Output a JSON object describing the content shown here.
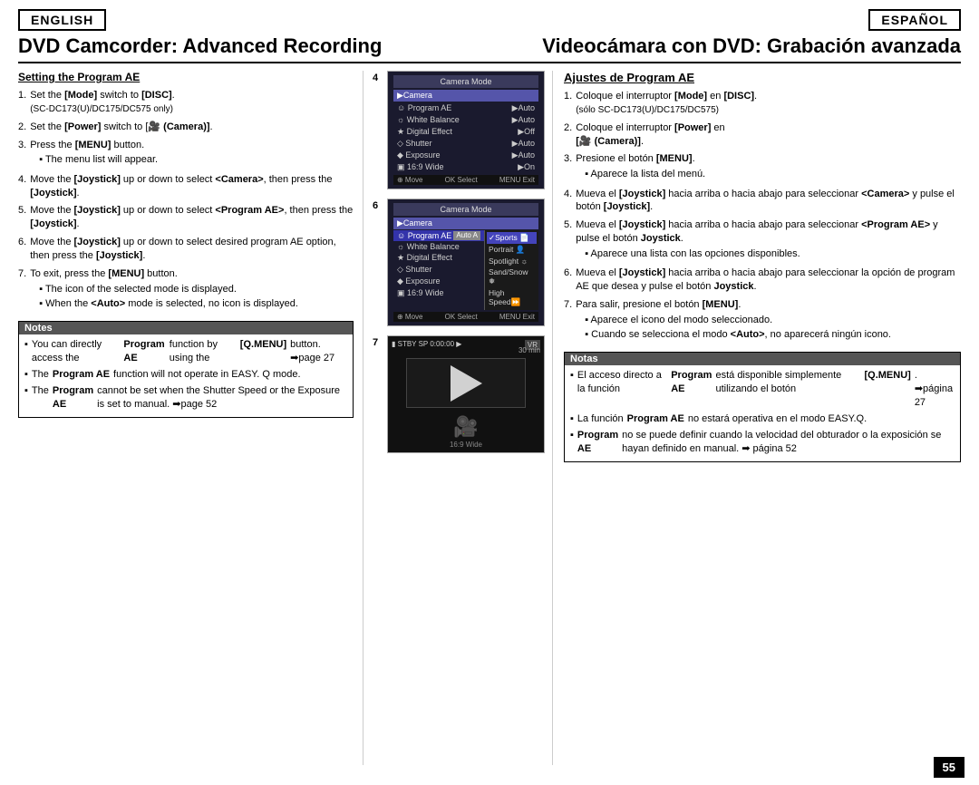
{
  "header": {
    "lang_en": "ENGLISH",
    "lang_es": "ESPAÑOL"
  },
  "title": {
    "en": "DVD Camcorder: Advanced Recording",
    "es": "Videocámara con DVD: Grabación avanzada"
  },
  "english_section": {
    "heading": "Setting the Program AE",
    "steps": [
      {
        "num": "1.",
        "text": "Set the [Mode] switch to [DISC].",
        "sub": "(SC-DC173(U)/DC175/DC575 only)"
      },
      {
        "num": "2.",
        "text": "Set the [Power] switch to [🎥 (Camera)]."
      },
      {
        "num": "3.",
        "text": "Press the [MENU] button.",
        "sub_bullets": [
          "The menu list will appear."
        ]
      },
      {
        "num": "4.",
        "text": "Move the [Joystick] up or down to select <Camera>, then press the [Joystick]."
      },
      {
        "num": "5.",
        "text": "Move the [Joystick] up or down to select <Program AE>, then press the [Joystick]."
      },
      {
        "num": "6.",
        "text": "Move the [Joystick] up or down to select desired program AE option, then press the [Joystick]."
      },
      {
        "num": "7.",
        "text": "To exit, press the [MENU] button.",
        "sub_bullets": [
          "The icon of the selected mode is displayed.",
          "When the <Auto> mode is selected, no icon is displayed."
        ]
      }
    ],
    "notes_title": "Notes",
    "notes": [
      "You can directly access the Program AE function by using the [Q.MENU] button. ➡page 27",
      "The Program AE function will not operate in EASY. Q mode.",
      "The Program AE cannot be set when the Shutter Speed or the Exposure is set to manual. ➡page 52"
    ]
  },
  "spanish_section": {
    "heading": "Ajustes de Program AE",
    "steps": [
      {
        "num": "1.",
        "text": "Coloque el interruptor [Mode] en [DISC]. (sólo SC-DC173(U)/DC175/DC575)"
      },
      {
        "num": "2.",
        "text": "Coloque el interruptor [Power] en [🎥 (Camera)]."
      },
      {
        "num": "3.",
        "text": "Presione el botón [MENU].",
        "sub_bullets": [
          "Aparece la lista del menú."
        ]
      },
      {
        "num": "4.",
        "text": "Mueva el [Joystick] hacia arriba o hacia abajo para seleccionar <Camera> y pulse el botón [Joystick]."
      },
      {
        "num": "5.",
        "text": "Mueva el [Joystick] hacia arriba o hacia abajo para seleccionar <Program AE> y pulse el botón [Joystick].",
        "sub_bullets": [
          "Aparece una lista con las opciones disponibles."
        ]
      },
      {
        "num": "6.",
        "text": "Mueva el [Joystick] hacia arriba o hacia abajo para seleccionar la opción de program AE que desea y pulse el botón [Joystick]."
      },
      {
        "num": "7.",
        "text": "Para salir, presione el botón [MENU].",
        "sub_bullets": [
          "Aparece el icono del modo seleccionado.",
          "Cuando se selecciona el modo <Auto>, no aparecerá ningún icono."
        ]
      }
    ],
    "notes_title": "Notas",
    "notes": [
      "El acceso directo a la función Program AE está disponible simplemente utilizando el botón [Q.MENU]. ➡página 27",
      "La función Program AE no estará operativa en el modo EASY.Q.",
      "Program AE no se puede definir cuando la velocidad del obturador o la exposición se hayan definido en manual. ➡ página 52"
    ]
  },
  "diagrams": {
    "label4": "4",
    "label6": "6",
    "label7": "7",
    "menu1": {
      "title": "Camera Mode",
      "selected": "▶Camera",
      "items": [
        {
          "icon": "☺",
          "label": "Program AE",
          "value": "▶Auto"
        },
        {
          "icon": "☼",
          "label": "White Balance",
          "value": "▶Auto"
        },
        {
          "icon": "★",
          "label": "Digital Effect",
          "value": "▶Off"
        },
        {
          "icon": "◎",
          "label": "Shutter",
          "value": "▶Auto"
        },
        {
          "icon": "◈",
          "label": "Exposure",
          "value": "▶Auto"
        },
        {
          "icon": "⊞",
          "label": "16:9 Wide",
          "value": "▶On"
        }
      ],
      "bottom": "Move  Select  Exit"
    },
    "menu2": {
      "title": "Camera Mode",
      "selected": "▶Camera",
      "items": [
        {
          "icon": "☺",
          "label": "Program AE",
          "value": "Auto",
          "highlight": true
        },
        {
          "icon": "☼",
          "label": "White Balance",
          "value": "Sports"
        },
        {
          "icon": "★",
          "label": "Digital Effect",
          "value": "Portrait"
        },
        {
          "icon": "◎",
          "label": "Shutter",
          "value": "Spotlight"
        },
        {
          "icon": "◈",
          "label": "Exposure",
          "value": "Sand/Snow"
        },
        {
          "icon": "⊞",
          "label": "16:9 Wide",
          "value": "High Speed"
        }
      ],
      "bottom": "Move  Select  Exit"
    },
    "camera": {
      "status": "STBY SP  0:00:00",
      "time": "30 min",
      "label": "16:9 Wide"
    }
  },
  "page_number": "55"
}
